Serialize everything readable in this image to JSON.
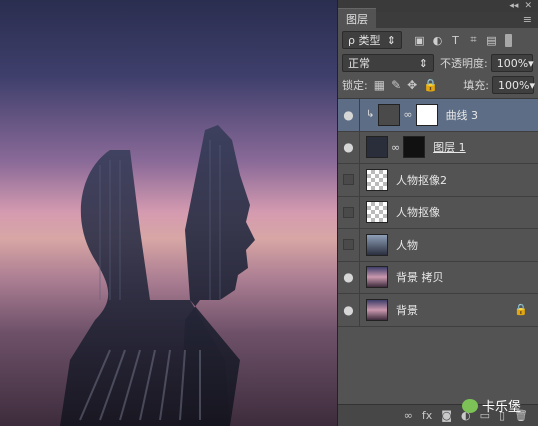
{
  "panel": {
    "tab_title": "图层",
    "collapse_glyph": "◂◂",
    "close_glyph": "✕",
    "menu_glyph": "≡",
    "filter": {
      "kind_label": "ρ 类型",
      "icons": [
        "image-filter-icon",
        "adjustment-filter-icon",
        "type-filter-icon",
        "shape-filter-icon",
        "smart-object-filter-icon"
      ],
      "icon_glyphs": [
        "▣",
        "◐",
        "T",
        "⌗",
        "▤"
      ]
    },
    "blend_mode": "正常",
    "opacity_label": "不透明度:",
    "opacity_value": "100%",
    "lock_label": "锁定:",
    "lock_glyphs": [
      "▦",
      "✎",
      "✥",
      "🔒"
    ],
    "fill_label": "填充:",
    "fill_value": "100%"
  },
  "layers": [
    {
      "name": "曲线 3",
      "visible": true,
      "selected": true,
      "type": "adjustment"
    },
    {
      "name": "图层 1",
      "visible": true,
      "selected": false,
      "type": "masked"
    },
    {
      "name": "人物抠像2",
      "visible": false,
      "selected": false,
      "type": "cutout"
    },
    {
      "name": "人物抠像",
      "visible": false,
      "selected": false,
      "type": "cutout"
    },
    {
      "name": "人物",
      "visible": false,
      "selected": false,
      "type": "photo"
    },
    {
      "name": "背景 拷贝",
      "visible": true,
      "selected": false,
      "type": "photo"
    },
    {
      "name": "背景",
      "visible": true,
      "selected": false,
      "type": "photo",
      "locked": true
    }
  ],
  "bottom_icons": [
    "link-icon",
    "fx-icon",
    "mask-icon",
    "adjustment-icon",
    "group-icon",
    "new-layer-icon",
    "trash-icon"
  ],
  "bottom_glyphs": [
    "∞",
    "fx",
    "◙",
    "◐",
    "▭",
    "▯",
    "🗑"
  ],
  "watermark": {
    "text": "卡乐堡"
  },
  "colors": {
    "panel_bg": "#535353",
    "selected_row": "#5d6d85",
    "canvas_sky_top": "#2a2e4f",
    "canvas_glow": "#d59bb0"
  }
}
